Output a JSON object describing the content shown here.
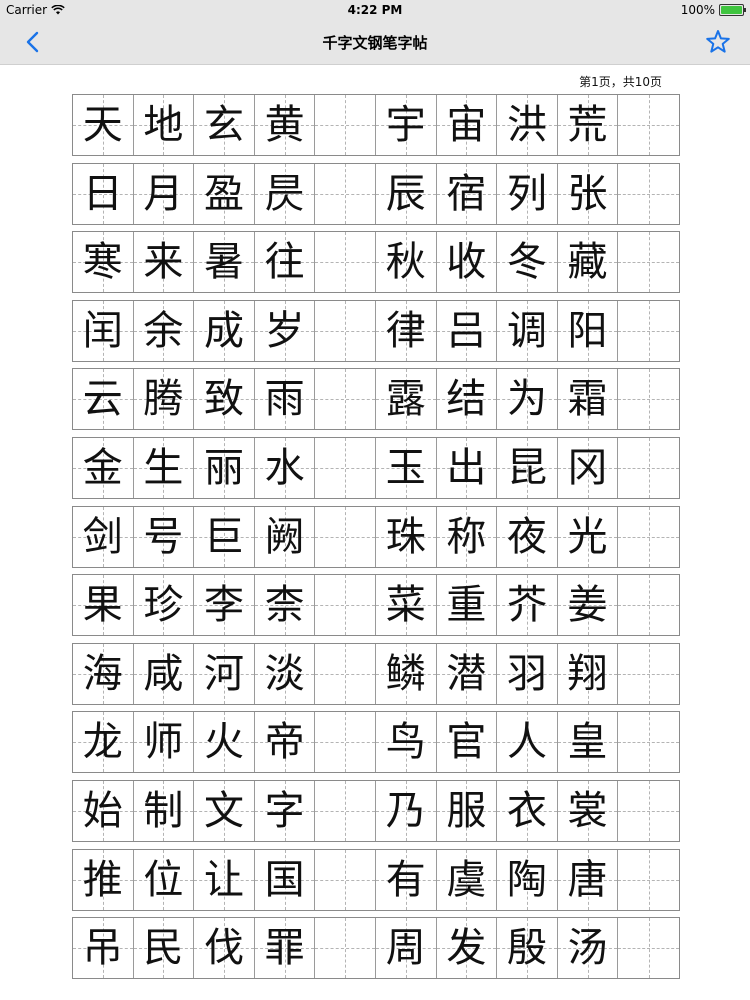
{
  "status_bar": {
    "carrier": "Carrier",
    "time": "4:22 PM",
    "battery": "100%",
    "battery_level": 1.0,
    "battery_color": "#3fc43f"
  },
  "nav": {
    "title": "千字文钢笔字帖",
    "back_icon": "chevron-left-icon",
    "favorite_icon": "star-outline-icon",
    "tint_color": "#1a73e8"
  },
  "page_indicator": "第1页，共10页",
  "rows": [
    [
      "天",
      "地",
      "玄",
      "黄",
      "",
      "宇",
      "宙",
      "洪",
      "荒",
      ""
    ],
    [
      "日",
      "月",
      "盈",
      "昃",
      "",
      "辰",
      "宿",
      "列",
      "张",
      ""
    ],
    [
      "寒",
      "来",
      "暑",
      "往",
      "",
      "秋",
      "收",
      "冬",
      "藏",
      ""
    ],
    [
      "闰",
      "余",
      "成",
      "岁",
      "",
      "律",
      "吕",
      "调",
      "阳",
      ""
    ],
    [
      "云",
      "腾",
      "致",
      "雨",
      "",
      "露",
      "结",
      "为",
      "霜",
      ""
    ],
    [
      "金",
      "生",
      "丽",
      "水",
      "",
      "玉",
      "出",
      "昆",
      "冈",
      ""
    ],
    [
      "剑",
      "号",
      "巨",
      "阙",
      "",
      "珠",
      "称",
      "夜",
      "光",
      ""
    ],
    [
      "果",
      "珍",
      "李",
      "柰",
      "",
      "菜",
      "重",
      "芥",
      "姜",
      ""
    ],
    [
      "海",
      "咸",
      "河",
      "淡",
      "",
      "鳞",
      "潜",
      "羽",
      "翔",
      ""
    ],
    [
      "龙",
      "师",
      "火",
      "帝",
      "",
      "鸟",
      "官",
      "人",
      "皇",
      ""
    ],
    [
      "始",
      "制",
      "文",
      "字",
      "",
      "乃",
      "服",
      "衣",
      "裳",
      ""
    ],
    [
      "推",
      "位",
      "让",
      "国",
      "",
      "有",
      "虞",
      "陶",
      "唐",
      ""
    ],
    [
      "吊",
      "民",
      "伐",
      "罪",
      "",
      "周",
      "发",
      "殷",
      "汤",
      ""
    ]
  ]
}
